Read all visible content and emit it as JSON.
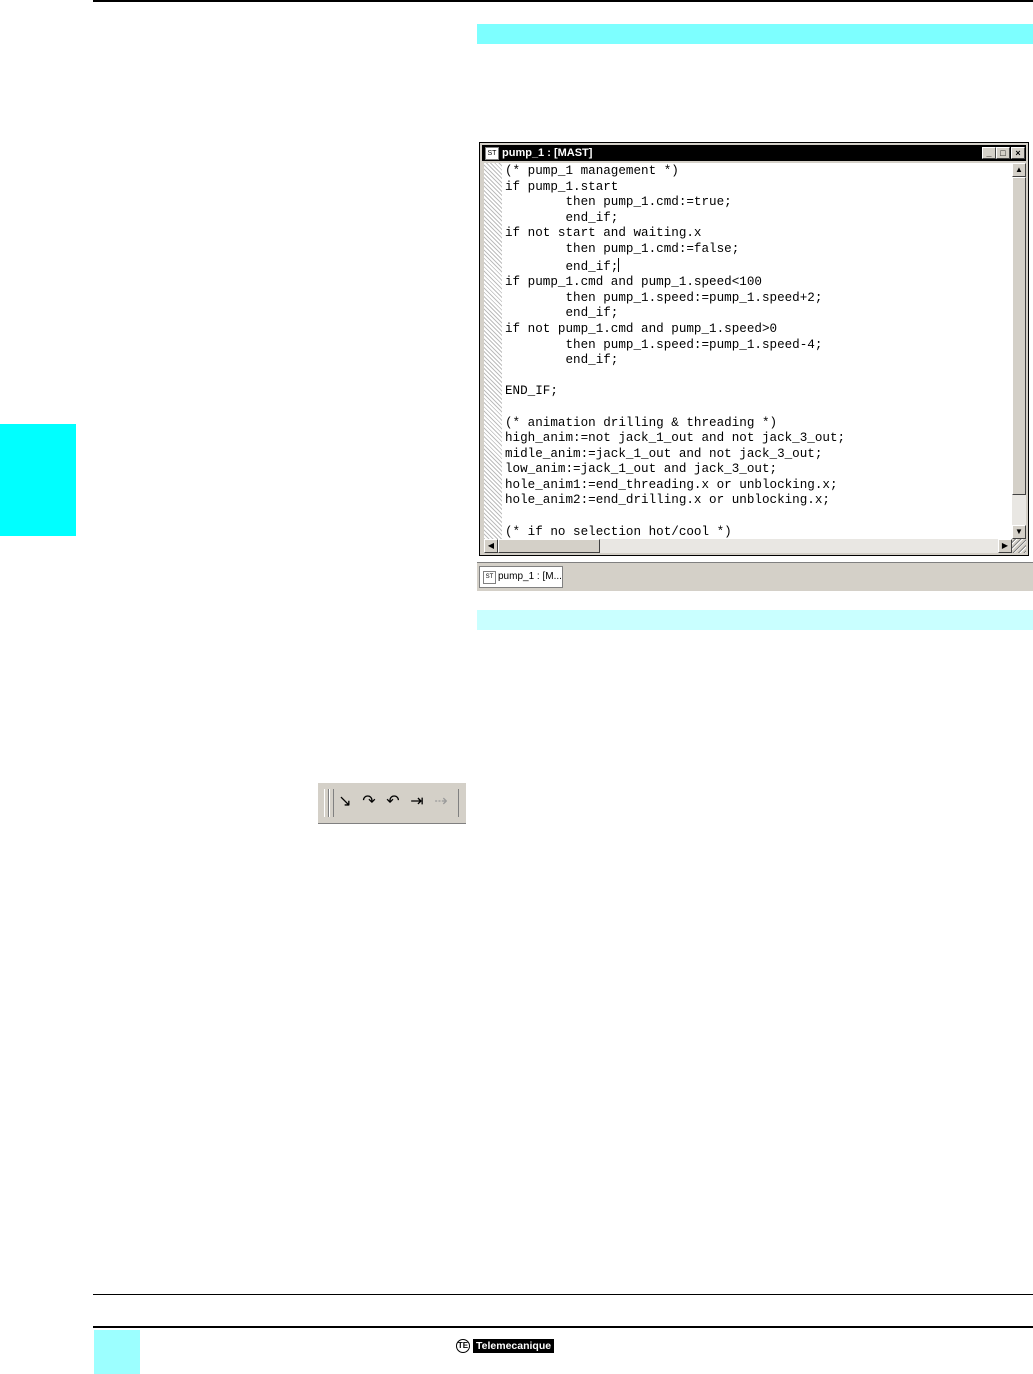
{
  "window": {
    "title": "pump_1 : [MAST]",
    "title_icon": "ST",
    "minimize_glyph": "_",
    "maximize_glyph": "□",
    "close_glyph": "×"
  },
  "code_lines": [
    "(* pump_1 management *)",
    "if pump_1.start",
    "        then pump_1.cmd:=true;",
    "        end_if;",
    "if not start and waiting.x",
    "        then pump_1.cmd:=false;",
    "        end_if;",
    "if pump_1.cmd and pump_1.speed<100",
    "        then pump_1.speed:=pump_1.speed+2;",
    "        end_if;",
    "if not pump_1.cmd and pump_1.speed>0",
    "        then pump_1.speed:=pump_1.speed-4;",
    "        end_if;",
    "",
    "END_IF;",
    "",
    "(* animation drilling & threading *)",
    "high_anim:=not jack_1_out and not jack_3_out;",
    "midle_anim:=jack_1_out and not jack_3_out;",
    "low_anim:=jack_1_out and jack_3_out;",
    "hole_anim1:=end_threading.x or unblocking.x;",
    "hole_anim2:=end_drilling.x or unblocking.x;",
    "",
    "(* if no selection hot/cool *)"
  ],
  "caret_line": 6,
  "scrollbars": {
    "up": "▲",
    "down": "▼",
    "left": "◀",
    "right": "▶"
  },
  "taskbar": {
    "tab_label": "pump_1 : [M...",
    "tab_icon": "ST"
  },
  "toolbar_icons": [
    {
      "name": "step-into-icon",
      "glyph": "↘",
      "enabled": true
    },
    {
      "name": "step-over-icon",
      "glyph": "↷",
      "enabled": true
    },
    {
      "name": "step-out-icon",
      "glyph": "↶",
      "enabled": true
    },
    {
      "name": "continue-icon",
      "glyph": "⇥",
      "enabled": true
    },
    {
      "name": "go-to-icon",
      "glyph": "⇢",
      "enabled": false
    }
  ],
  "footer": {
    "brand": "Telemecanique",
    "logo_glyph": "TE"
  },
  "colors": {
    "band_1": "#7dffff",
    "band_2": "#c9ffff",
    "side_tab": "#00ffff",
    "footer_square": "#9cffff",
    "window_title_bar": "#000000"
  }
}
